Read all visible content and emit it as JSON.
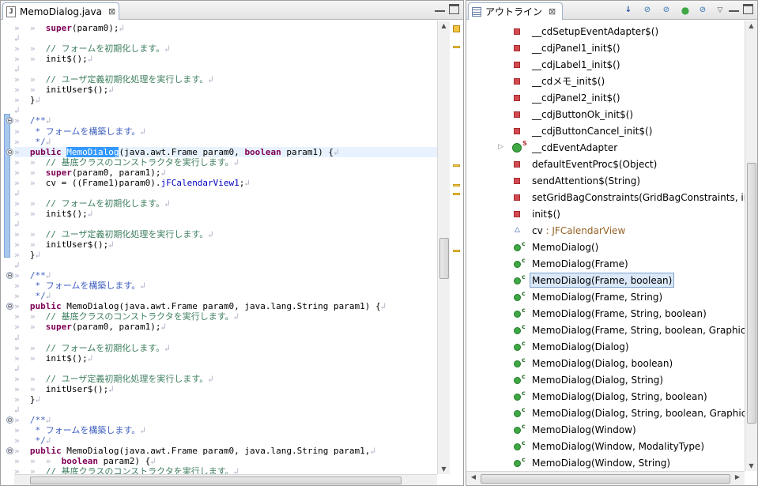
{
  "editor": {
    "tab_title": "MemoDialog.java",
    "tab_close": "⊠",
    "lines": [
      {
        "tokens": [
          {
            "t": "»  »  ",
            "c": "ws"
          },
          {
            "t": "super",
            "c": "kw"
          },
          {
            "t": "(param0);"
          },
          {
            "t": "↲",
            "c": "lf"
          }
        ]
      },
      {
        "tokens": [
          {
            "t": "↲",
            "c": "lf"
          }
        ]
      },
      {
        "tokens": [
          {
            "t": "»  »  ",
            "c": "ws"
          },
          {
            "t": "// フォームを初期化します。",
            "c": "cm"
          },
          {
            "t": "↲",
            "c": "lf"
          }
        ]
      },
      {
        "tokens": [
          {
            "t": "»  »  ",
            "c": "ws"
          },
          {
            "t": "init$();"
          },
          {
            "t": "↲",
            "c": "lf"
          }
        ]
      },
      {
        "tokens": [
          {
            "t": "↲",
            "c": "lf"
          }
        ]
      },
      {
        "tokens": [
          {
            "t": "»  »  ",
            "c": "ws"
          },
          {
            "t": "// ユーザ定義初期化処理を実行します。",
            "c": "cm"
          },
          {
            "t": "↲",
            "c": "lf"
          }
        ]
      },
      {
        "tokens": [
          {
            "t": "»  »  ",
            "c": "ws"
          },
          {
            "t": "initUser$();"
          },
          {
            "t": "↲",
            "c": "lf"
          }
        ]
      },
      {
        "tokens": [
          {
            "t": "»  ",
            "c": "ws"
          },
          {
            "t": "}"
          },
          {
            "t": "↲",
            "c": "lf"
          }
        ]
      },
      {
        "tokens": [
          {
            "t": "↲",
            "c": "lf"
          }
        ]
      },
      {
        "fold": "⊖",
        "tokens": [
          {
            "t": "»  ",
            "c": "ws"
          },
          {
            "t": "/**",
            "c": "jd"
          },
          {
            "t": "↲",
            "c": "lf"
          }
        ]
      },
      {
        "tokens": [
          {
            "t": "»  ",
            "c": "ws"
          },
          {
            "t": " * フォームを構築します。",
            "c": "jd"
          },
          {
            "t": "↲",
            "c": "lf"
          }
        ]
      },
      {
        "tokens": [
          {
            "t": "»  ",
            "c": "ws"
          },
          {
            "t": " */",
            "c": "jd"
          },
          {
            "t": "↲",
            "c": "lf"
          }
        ]
      },
      {
        "fold": "⊖",
        "current": true,
        "tokens": [
          {
            "t": "»  ",
            "c": "ws"
          },
          {
            "t": "public",
            "c": "kw"
          },
          {
            "t": " "
          },
          {
            "t": "MemoDialog",
            "c": "sel"
          },
          {
            "t": "(java.awt.Frame param0, "
          },
          {
            "t": "boolean",
            "c": "kw"
          },
          {
            "t": " param1) {"
          },
          {
            "t": "↲",
            "c": "lf"
          }
        ]
      },
      {
        "tokens": [
          {
            "t": "»  »  ",
            "c": "ws"
          },
          {
            "t": "// 基底クラスのコンストラクタを実行します。",
            "c": "cm"
          },
          {
            "t": "↲",
            "c": "lf"
          }
        ]
      },
      {
        "tokens": [
          {
            "t": "»  »  ",
            "c": "ws"
          },
          {
            "t": "super",
            "c": "kw"
          },
          {
            "t": "(param0, param1);"
          },
          {
            "t": "↲",
            "c": "lf"
          }
        ]
      },
      {
        "tokens": [
          {
            "t": "»  »  ",
            "c": "ws"
          },
          {
            "t": "cv = ((Frame1)param0)."
          },
          {
            "t": "jFCalendarView1",
            "c": "fld"
          },
          {
            "t": ";"
          },
          {
            "t": "↲",
            "c": "lf"
          }
        ]
      },
      {
        "tokens": [
          {
            "t": "↲",
            "c": "lf"
          }
        ]
      },
      {
        "tokens": [
          {
            "t": "»  »  ",
            "c": "ws"
          },
          {
            "t": "// フォームを初期化します。",
            "c": "cm"
          },
          {
            "t": "↲",
            "c": "lf"
          }
        ]
      },
      {
        "tokens": [
          {
            "t": "»  »  ",
            "c": "ws"
          },
          {
            "t": "init$();"
          },
          {
            "t": "↲",
            "c": "lf"
          }
        ]
      },
      {
        "tokens": [
          {
            "t": "↲",
            "c": "lf"
          }
        ]
      },
      {
        "tokens": [
          {
            "t": "»  »  ",
            "c": "ws"
          },
          {
            "t": "// ユーザ定義初期化処理を実行します。",
            "c": "cm"
          },
          {
            "t": "↲",
            "c": "lf"
          }
        ]
      },
      {
        "tokens": [
          {
            "t": "»  »  ",
            "c": "ws"
          },
          {
            "t": "initUser$();"
          },
          {
            "t": "↲",
            "c": "lf"
          }
        ]
      },
      {
        "tokens": [
          {
            "t": "»  ",
            "c": "ws"
          },
          {
            "t": "}"
          },
          {
            "t": "↲",
            "c": "lf"
          }
        ]
      },
      {
        "tokens": [
          {
            "t": "↲",
            "c": "lf"
          }
        ]
      },
      {
        "fold": "⊖",
        "tokens": [
          {
            "t": "»  ",
            "c": "ws"
          },
          {
            "t": "/**",
            "c": "jd"
          },
          {
            "t": "↲",
            "c": "lf"
          }
        ]
      },
      {
        "tokens": [
          {
            "t": "»  ",
            "c": "ws"
          },
          {
            "t": " * フォームを構築します。",
            "c": "jd"
          },
          {
            "t": "↲",
            "c": "lf"
          }
        ]
      },
      {
        "tokens": [
          {
            "t": "»  ",
            "c": "ws"
          },
          {
            "t": " */",
            "c": "jd"
          },
          {
            "t": "↲",
            "c": "lf"
          }
        ]
      },
      {
        "fold": "⊖",
        "tokens": [
          {
            "t": "»  ",
            "c": "ws"
          },
          {
            "t": "public",
            "c": "kw"
          },
          {
            "t": " MemoDialog(java.awt.Frame param0, java.lang.String param1) {"
          },
          {
            "t": "↲",
            "c": "lf"
          }
        ]
      },
      {
        "tokens": [
          {
            "t": "»  »  ",
            "c": "ws"
          },
          {
            "t": "// 基底クラスのコンストラクタを実行します。",
            "c": "cm"
          },
          {
            "t": "↲",
            "c": "lf"
          }
        ]
      },
      {
        "tokens": [
          {
            "t": "»  »  ",
            "c": "ws"
          },
          {
            "t": "super",
            "c": "kw"
          },
          {
            "t": "(param0, param1);"
          },
          {
            "t": "↲",
            "c": "lf"
          }
        ]
      },
      {
        "tokens": [
          {
            "t": "↲",
            "c": "lf"
          }
        ]
      },
      {
        "tokens": [
          {
            "t": "»  »  ",
            "c": "ws"
          },
          {
            "t": "// フォームを初期化します。",
            "c": "cm"
          },
          {
            "t": "↲",
            "c": "lf"
          }
        ]
      },
      {
        "tokens": [
          {
            "t": "»  »  ",
            "c": "ws"
          },
          {
            "t": "init$();"
          },
          {
            "t": "↲",
            "c": "lf"
          }
        ]
      },
      {
        "tokens": [
          {
            "t": "↲",
            "c": "lf"
          }
        ]
      },
      {
        "tokens": [
          {
            "t": "»  »  ",
            "c": "ws"
          },
          {
            "t": "// ユーザ定義初期化処理を実行します。",
            "c": "cm"
          },
          {
            "t": "↲",
            "c": "lf"
          }
        ]
      },
      {
        "tokens": [
          {
            "t": "»  »  ",
            "c": "ws"
          },
          {
            "t": "initUser$();"
          },
          {
            "t": "↲",
            "c": "lf"
          }
        ]
      },
      {
        "tokens": [
          {
            "t": "»  ",
            "c": "ws"
          },
          {
            "t": "}"
          },
          {
            "t": "↲",
            "c": "lf"
          }
        ]
      },
      {
        "tokens": [
          {
            "t": "↲",
            "c": "lf"
          }
        ]
      },
      {
        "fold": "⊖",
        "tokens": [
          {
            "t": "»  ",
            "c": "ws"
          },
          {
            "t": "/**",
            "c": "jd"
          },
          {
            "t": "↲",
            "c": "lf"
          }
        ]
      },
      {
        "tokens": [
          {
            "t": "»  ",
            "c": "ws"
          },
          {
            "t": " * フォームを構築します。",
            "c": "jd"
          },
          {
            "t": "↲",
            "c": "lf"
          }
        ]
      },
      {
        "tokens": [
          {
            "t": "»  ",
            "c": "ws"
          },
          {
            "t": " */",
            "c": "jd"
          },
          {
            "t": "↲",
            "c": "lf"
          }
        ]
      },
      {
        "fold": "⊖",
        "tokens": [
          {
            "t": "»  ",
            "c": "ws"
          },
          {
            "t": "public",
            "c": "kw"
          },
          {
            "t": " MemoDialog(java.awt.Frame param0, java.lang.String param1,"
          },
          {
            "t": "↲",
            "c": "lf"
          }
        ]
      },
      {
        "tokens": [
          {
            "t": "»  »  »  ",
            "c": "ws"
          },
          {
            "t": "boolean",
            "c": "kw"
          },
          {
            "t": " param2) {"
          },
          {
            "t": "↲",
            "c": "lf"
          }
        ]
      },
      {
        "tokens": [
          {
            "t": "»  »  ",
            "c": "ws"
          },
          {
            "t": "// 基底クラスのコンストラクタを実行します。",
            "c": "cm"
          },
          {
            "t": "↲",
            "c": "lf"
          }
        ]
      }
    ]
  },
  "outline": {
    "tab_title": "アウトライン",
    "tab_close": "⊠",
    "toolbar_icons": [
      "sort-alphabetically-icon",
      "hide-fields-icon",
      "hide-static-icon",
      "hide-non-public-icon",
      "hide-local-types-icon",
      "view-menu-icon"
    ],
    "items": [
      {
        "label": "__cdSetupEventAdapter$()",
        "icon": "private"
      },
      {
        "label": "__cdjPanel1_init$()",
        "icon": "private"
      },
      {
        "label": "__cdjLabel1_init$()",
        "icon": "private"
      },
      {
        "label": "__cdメモ_init$()",
        "icon": "private"
      },
      {
        "label": "__cdjPanel2_init$()",
        "icon": "private"
      },
      {
        "label": "__cdjButtonOk_init$()",
        "icon": "private"
      },
      {
        "label": "__cdjButtonCancel_init$()",
        "icon": "private"
      },
      {
        "label": "__cdEventAdapter",
        "icon": "inner",
        "twisty": "▷",
        "decorator": "S"
      },
      {
        "label": "defaultEventProc$(Object)",
        "icon": "private"
      },
      {
        "label": "sendAttention$(String)",
        "icon": "private"
      },
      {
        "label": "setGridBagConstraints(GridBagConstraints, int",
        "icon": "private"
      },
      {
        "label": "init$()",
        "icon": "private"
      },
      {
        "label": "cv",
        "icon": "field",
        "type": " : JFCalendarView"
      },
      {
        "label": "MemoDialog()",
        "icon": "public",
        "decorator": "c"
      },
      {
        "label": "MemoDialog(Frame)",
        "icon": "public",
        "decorator": "c"
      },
      {
        "label": "MemoDialog(Frame, boolean)",
        "icon": "public",
        "decorator": "c",
        "selected": true
      },
      {
        "label": "MemoDialog(Frame, String)",
        "icon": "public",
        "decorator": "c"
      },
      {
        "label": "MemoDialog(Frame, String, boolean)",
        "icon": "public",
        "decorator": "c"
      },
      {
        "label": "MemoDialog(Frame, String, boolean, Graphics",
        "icon": "public",
        "decorator": "c"
      },
      {
        "label": "MemoDialog(Dialog)",
        "icon": "public",
        "decorator": "c"
      },
      {
        "label": "MemoDialog(Dialog, boolean)",
        "icon": "public",
        "decorator": "c"
      },
      {
        "label": "MemoDialog(Dialog, String)",
        "icon": "public",
        "decorator": "c"
      },
      {
        "label": "MemoDialog(Dialog, String, boolean)",
        "icon": "public",
        "decorator": "c"
      },
      {
        "label": "MemoDialog(Dialog, String, boolean, Graphics",
        "icon": "public",
        "decorator": "c"
      },
      {
        "label": "MemoDialog(Window)",
        "icon": "public",
        "decorator": "c"
      },
      {
        "label": "MemoDialog(Window, ModalityType)",
        "icon": "public",
        "decorator": "c"
      },
      {
        "label": "MemoDialog(Window, String)",
        "icon": "public",
        "decorator": "c"
      }
    ]
  }
}
